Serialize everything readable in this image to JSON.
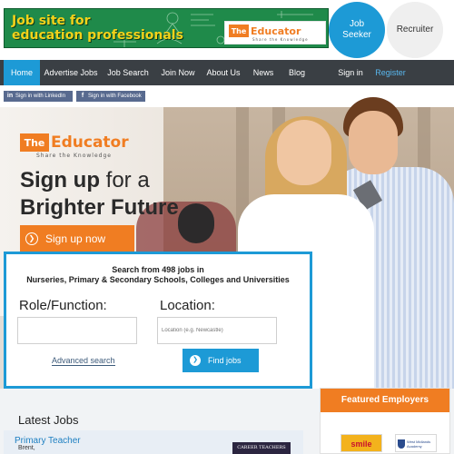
{
  "header": {
    "banner_text_line1": "Job site for",
    "banner_text_line2": "education professionals",
    "logo_the": "The",
    "logo_word": "Educator",
    "logo_tagline": "Share the Knowledge",
    "jobseeker_label_1": "Job",
    "jobseeker_label_2": "Seeker",
    "recruiter_label": "Recruiter"
  },
  "nav": {
    "items": [
      {
        "label": "Home"
      },
      {
        "label": "Advertise Jobs"
      },
      {
        "label": "Job Search"
      },
      {
        "label": "Join Now"
      },
      {
        "label": "About Us"
      },
      {
        "label": "News"
      },
      {
        "label": "Blog"
      }
    ],
    "signin_label": "Sign in",
    "register_label": "Register"
  },
  "social": {
    "linkedin_label": "Sign in with LinkedIn",
    "facebook_label": "Sign in with Facebook"
  },
  "hero": {
    "logo_the": "The",
    "logo_word": "Educator",
    "logo_tagline": "Share the Knowledge",
    "title_line1_bold": "Sign up",
    "title_line1_light": " for a",
    "title_line2": "Brighter Future",
    "signup_button": "Sign up now"
  },
  "search": {
    "heading_line1": "Search from 498 jobs in",
    "heading_line2": "Nurseries, Primary & Secondary Schools, Colleges and Universities",
    "role_label": "Role/Function:",
    "role_value": "",
    "location_label": "Location:",
    "location_placeholder": "Location (e.g. Newcastle)",
    "advanced_link": "Advanced search",
    "find_button": "Find jobs"
  },
  "latest": {
    "title": "Latest Jobs",
    "jobs": [
      {
        "title": "Primary Teacher",
        "location": "Brent,",
        "employer_logo_text": "CAREER TEACHERS"
      }
    ]
  },
  "featured": {
    "title": "Featured Employers",
    "employers": [
      {
        "logo_text": "smile"
      },
      {
        "logo_text": "West Midlands Academy"
      }
    ]
  },
  "colors": {
    "accent_blue": "#1d9ad6",
    "accent_orange": "#f07d22",
    "nav_background": "#3a3f44"
  }
}
